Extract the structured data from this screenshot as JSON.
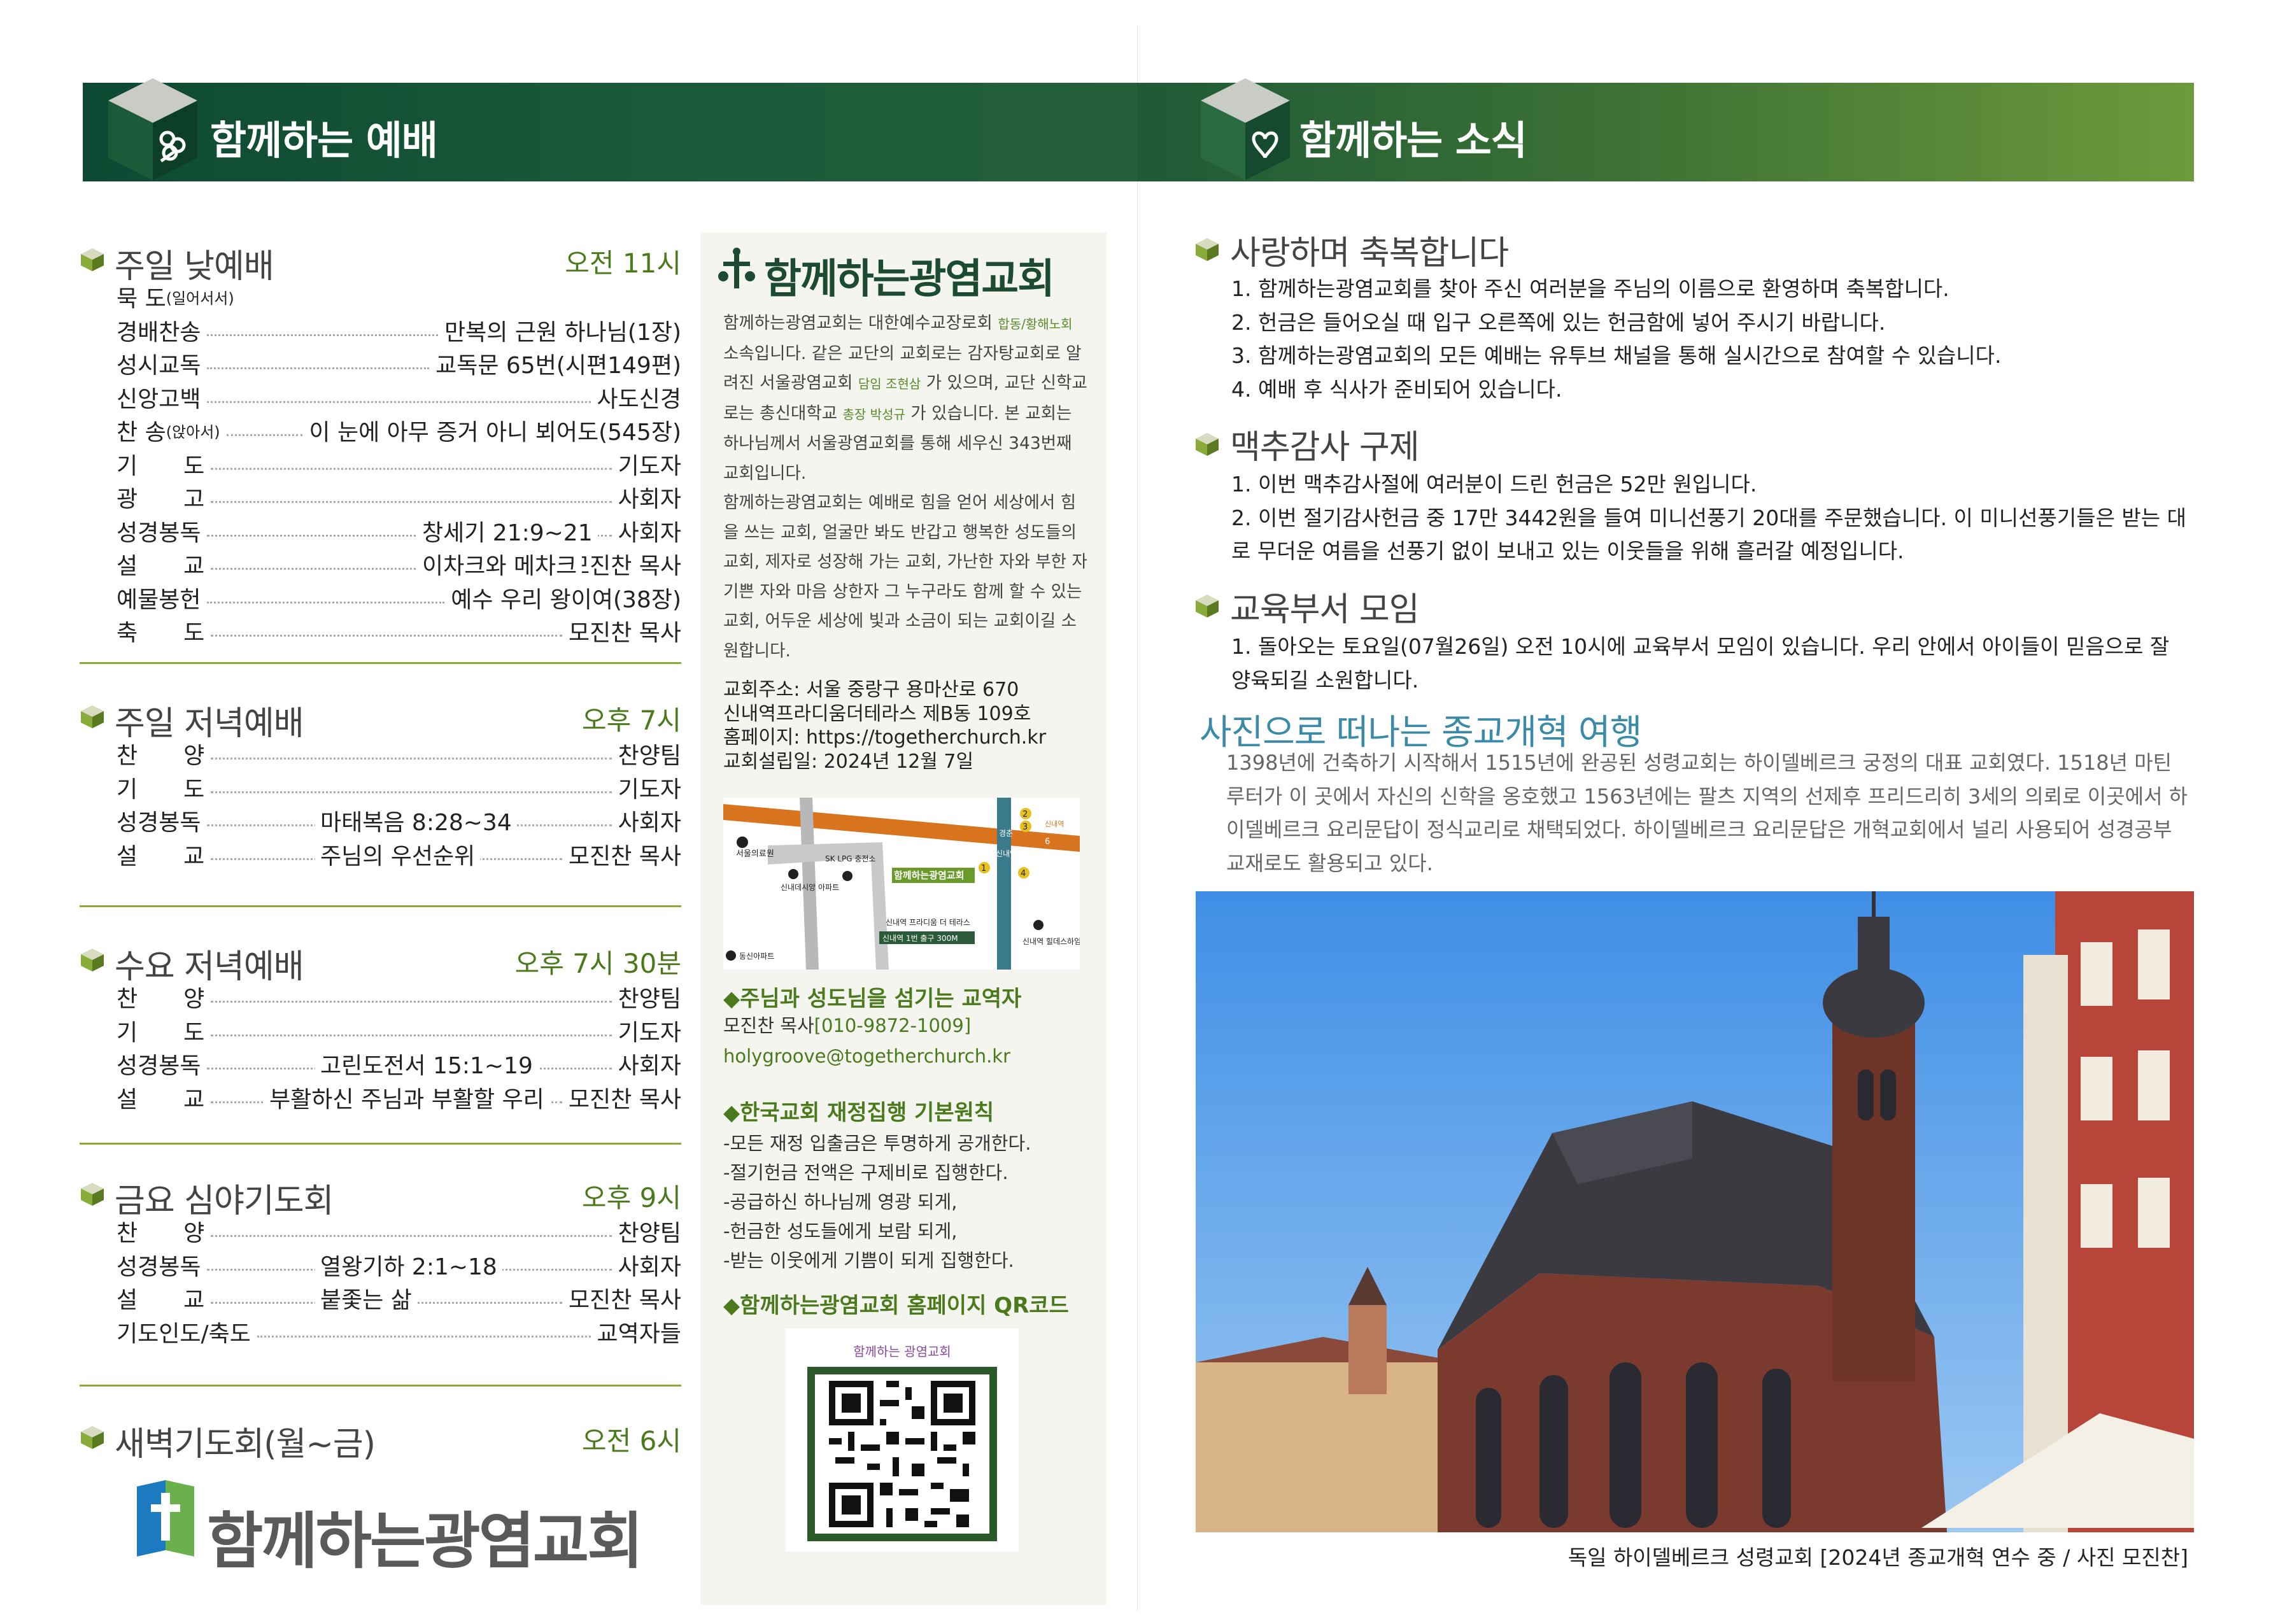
{
  "left": {
    "banner_title": "함께하는 예배",
    "sections": [
      {
        "title": "주일 낮예배",
        "time": "오전 11시",
        "rows": [
          {
            "label": "묵 도",
            "small": "(일어서서)",
            "mid": "",
            "right": ""
          },
          {
            "label": "경배찬송",
            "small": "",
            "mid": "",
            "right": "만복의 근원 하나님(1장)"
          },
          {
            "label": "성시교독",
            "small": "",
            "mid": "",
            "right": "교독문 65번(시편149편)"
          },
          {
            "label": "신앙고백",
            "small": "",
            "mid": "",
            "right": "사도신경"
          },
          {
            "label": "찬 송",
            "small": "(앉아서)",
            "mid": "",
            "right": "이 눈에 아무 증거 아니 뵈어도(545장)"
          },
          {
            "label": "기　　도",
            "small": "",
            "mid": "",
            "right": "기도자"
          },
          {
            "label": "광　　고",
            "small": "",
            "mid": "",
            "right": "사회자"
          },
          {
            "label": "성경봉독",
            "small": "",
            "mid": "창세기 21:9~21",
            "right": "사회자"
          },
          {
            "label": "설　　교",
            "small": "",
            "mid": "이차크와 메차크",
            "right": "모진찬 목사"
          },
          {
            "label": "예물봉헌",
            "small": "",
            "mid": "",
            "right": "예수 우리 왕이여(38장)"
          },
          {
            "label": "축　　도",
            "small": "",
            "mid": "",
            "right": "모진찬 목사"
          }
        ]
      },
      {
        "title": "주일 저녁예배",
        "time": "오후 7시",
        "rows": [
          {
            "label": "찬　　양",
            "small": "",
            "mid": "",
            "right": "찬양팀"
          },
          {
            "label": "기　　도",
            "small": "",
            "mid": "",
            "right": "기도자"
          },
          {
            "label": "성경봉독",
            "small": "",
            "mid": "마태복음 8:28~34",
            "right": "사회자"
          },
          {
            "label": "설　　교",
            "small": "",
            "mid": "주님의 우선순위",
            "right": "모진찬 목사"
          }
        ]
      },
      {
        "title": "수요 저녁예배",
        "time": "오후 7시 30분",
        "rows": [
          {
            "label": "찬　　양",
            "small": "",
            "mid": "",
            "right": "찬양팀"
          },
          {
            "label": "기　　도",
            "small": "",
            "mid": "",
            "right": "기도자"
          },
          {
            "label": "성경봉독",
            "small": "",
            "mid": "고린도전서 15:1~19",
            "right": "사회자"
          },
          {
            "label": "설　　교",
            "small": "",
            "mid": "부활하신 주님과 부활할 우리",
            "right": "모진찬 목사"
          }
        ]
      },
      {
        "title": "금요 심야기도회",
        "time": "오후 9시",
        "rows": [
          {
            "label": "찬　　양",
            "small": "",
            "mid": "",
            "right": "찬양팀"
          },
          {
            "label": "성경봉독",
            "small": "",
            "mid": "열왕기하 2:1~18",
            "right": "사회자"
          },
          {
            "label": "설　　교",
            "small": "",
            "mid": "붙좇는 삶",
            "right": "모진찬 목사"
          },
          {
            "label": "기도인도/축도",
            "small": "",
            "mid": "",
            "right": "교역자들"
          }
        ]
      },
      {
        "title": "새벽기도회(월~금)",
        "time": "오전 6시",
        "rows": []
      }
    ],
    "footer_logo": "함께하는광염교회"
  },
  "middle": {
    "brand_a": "함께하는",
    "brand_b": "광염교회",
    "intro_parts": [
      "함께하는광염교회는 대한예수교장로회 ",
      "합동/황해노회",
      " 소속입니다. 같은 교단의 교회로는 감자탕교회로 알려진 서울광염교회 ",
      "담임 조현삼",
      " 가 있으며, 교단 신학교로는 총신대학교 ",
      "총장 박성규",
      " 가 있습니다. 본 교회는 하나님께서 서울광염교회를 통해 세우신 343번째 교회입니다.",
      "함께하는광염교회는 예배로 힘을 얻어 세상에서 힘을 쓰는 교회, 얼굴만 봐도 반갑고 행복한 성도들의 교회, 제자로 성장해 가는 교회, 가난한 자와 부한 자 기쁜 자와 마음 상한자 그 누구라도 함께 할 수 있는 교회, 어두운 세상에 빛과 소금이 되는 교회이길 소원합니다."
    ],
    "address_lines": [
      "교회주소: 서울 중랑구 용마산로 670",
      "신내역프라디움더테라스 제B동 109호",
      "홈페이지: https://togetherchurch.kr",
      "교회설립일: 2024년 12월 7일"
    ],
    "map": {
      "seoul_hospital": "서울의료원",
      "sk_lpg": "SK LPG 충전소",
      "apt": "신내데시앙 아파트",
      "church": "함께하는광염교회",
      "exit": "신내역 프라디움 더 테라스",
      "exit2": "신내역 1번 출구 300M",
      "hill": "신내역 힐데스하임",
      "dongsin": "동신아파트",
      "gyeongchun": "경춘",
      "sinnae": "신내역",
      "num2": "2",
      "num3": "3",
      "num6": "6",
      "num1": "1",
      "num4": "4"
    },
    "staff_title": "◆주님과 성도님을 섬기는 교역자",
    "staff_name": "모진찬 목사",
    "staff_phone": "[010-9872-1009]",
    "staff_email": "holygroove@togetherchurch.kr",
    "finance_title": "◆한국교회 재정집행 기본원칙",
    "finance_lines": [
      "-모든 재정 입출금은 투명하게 공개한다.",
      "-절기헌금 전액은 구제비로 집행한다.",
      "-공급하신 하나님께 영광 되게,",
      "-헌금한 성도들에게 보람 되게,",
      "-받는 이웃에게 기쁨이 되게 집행한다."
    ],
    "qr_title": "◆함께하는광염교회 홈페이지 QR코드",
    "qr_label": "함께하는 광염교회"
  },
  "right": {
    "banner_title": "함께하는 소식",
    "welcome_title": "사랑하며 축복합니다",
    "welcome_items": [
      "1. 함께하는광염교회를 찾아 주신 여러분을 주님의 이름으로 환영하며 축복합니다.",
      "2. 헌금은 들어오실 때 입구 오른쪽에 있는 헌금함에 넣어 주시기 바랍니다.",
      "3. 함께하는광염교회의 모든 예배는 유투브 채널을 통해 실시간으로 참여할 수 있습니다.",
      "4. 예배 후 식사가 준비되어 있습니다."
    ],
    "relief_title": "맥추감사 구제",
    "relief_items": [
      "1. 이번 맥추감사절에 여러분이 드린 헌금은 52만 원입니다.",
      "2. 이번 절기감사헌금 중 17만 3442원을 들여 미니선풍기 20대를 주문했습니다. 이 미니선풍기들은 받는 대로 무더운 여름을 선풍기 없이 보내고 있는 이웃들을 위해 흘러갈 예정입니다."
    ],
    "edu_title": "교육부서 모임",
    "edu_items": [
      "1. 돌아오는 토요일(07월26일) 오전 10시에 교육부서 모임이 있습니다. 우리 안에서 아이들이 믿음으로 잘 양육되길 소원합니다."
    ],
    "trip_title": "사진으로 떠나는 종교개혁 여행",
    "trip_text": "1398년에 건축하기 시작해서 1515년에 완공된 성령교회는 하이델베르크 궁정의 대표 교회였다. 1518년 마틴 루터가 이 곳에서 자신의 신학을 옹호했고 1563년에는 팔츠 지역의 선제후 프리드리히 3세의 의뢰로 이곳에서 하이델베르크 요리문답이 정식교리로 채택되었다. 하이델베르크 요리문답은 개혁교회에서 널리 사용되어 성경공부 교재로도 활용되고 있다.",
    "photo_caption": "독일 하이델베르크 성령교회  [2024년 종교개혁 연수 중 / 사진 모진찬]"
  },
  "colors": {
    "banner_dark": "#0e4a33",
    "banner_light": "#6d9a3c",
    "accent_green": "#4a7a1c",
    "trip_blue": "#3a8aa8",
    "divider_green": "#8aaa3a"
  }
}
